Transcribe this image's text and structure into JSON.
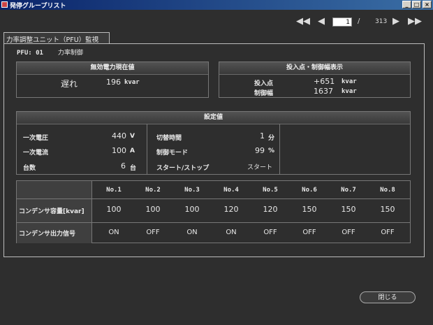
{
  "window": {
    "title": "発停グループリスト",
    "minimize": "_",
    "maximize": "□",
    "close": "×"
  },
  "pager": {
    "current": "1",
    "separator": "/",
    "total": "313"
  },
  "tab": {
    "label": "力率調整ユニット（PFU）監視"
  },
  "pfu": {
    "label": "PFU: 01",
    "name": "力率制御"
  },
  "reactive": {
    "header": "無効電力現在値",
    "status": "遅れ",
    "value": "196",
    "unit": "kvar"
  },
  "input_point": {
    "header": "投入点・制御幅表示",
    "rows": [
      {
        "label": "投入点",
        "value": "+651",
        "unit": "kvar"
      },
      {
        "label": "制御幅",
        "value": "1637",
        "unit": "kvar"
      }
    ]
  },
  "settings": {
    "header": "設定値",
    "left": [
      {
        "label": "一次電圧",
        "value": "440",
        "unit": "V"
      },
      {
        "label": "一次電流",
        "value": "100",
        "unit": "A"
      },
      {
        "label": "台数",
        "value": "6",
        "unit": "台"
      }
    ],
    "middle": [
      {
        "label": "切替時間",
        "value": "1",
        "unit": "分"
      },
      {
        "label": "制御モード",
        "value": "99",
        "unit": "%"
      },
      {
        "label": "スタート/ストップ",
        "value": "スタート",
        "unit": ""
      }
    ]
  },
  "condenser": {
    "columns": [
      "No.1",
      "No.2",
      "No.3",
      "No.4",
      "No.5",
      "No.6",
      "No.7",
      "No.8"
    ],
    "capacity_label": "コンデンサ容量[kvar]",
    "capacity": [
      "100",
      "100",
      "100",
      "120",
      "120",
      "150",
      "150",
      "150"
    ],
    "signal_label": "コンデンサ出力信号",
    "signal": [
      "ON",
      "OFF",
      "ON",
      "ON",
      "OFF",
      "OFF",
      "OFF",
      "OFF"
    ]
  },
  "close_button": "閉じる",
  "colors": {
    "background": "#2e2e2e",
    "titlebar": "#0a246a",
    "border": "#bcbcbc"
  }
}
